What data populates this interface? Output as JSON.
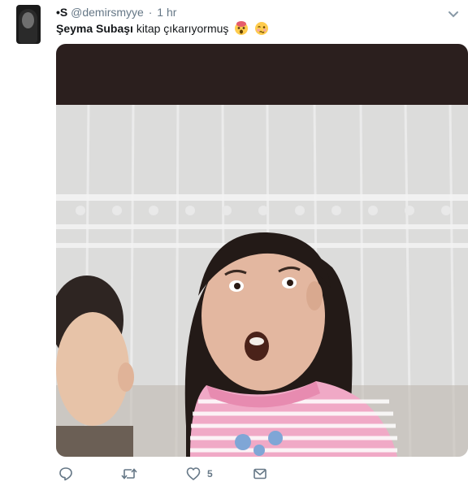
{
  "tweet": {
    "display_name": "•S",
    "handle": "@demirsmyye",
    "separator": "·",
    "time": "1 hr",
    "mention": "Şeyma Subaşı",
    "text": "kitap çıkarıyormuş",
    "emojis": [
      "shocked-face-emoji",
      "woozy-face-emoji"
    ]
  },
  "media": {
    "description_icon": "photo"
  },
  "actions": {
    "reply": {
      "icon": "reply-icon"
    },
    "retweet": {
      "icon": "retweet-icon"
    },
    "like": {
      "icon": "heart-icon",
      "count": "5"
    },
    "dm": {
      "icon": "envelope-icon"
    }
  },
  "colors": {
    "text": "#14171a",
    "secondary": "#657786",
    "background": "#ffffff"
  }
}
